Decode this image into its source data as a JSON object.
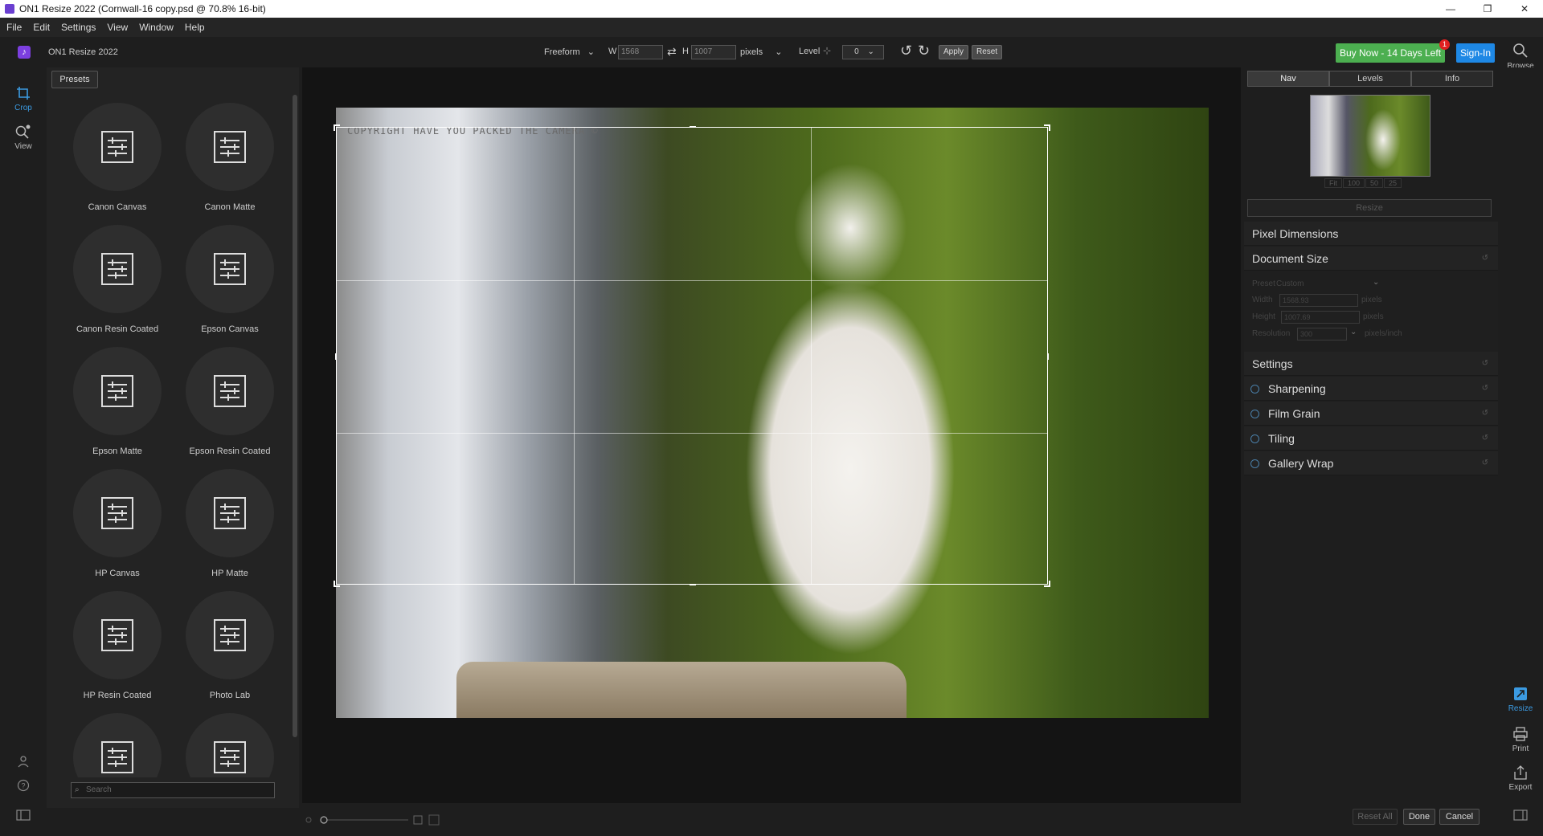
{
  "window": {
    "title": "ON1 Resize 2022 (Cornwall-16 copy.psd @ 70.8% 16-bit)",
    "controls": [
      "—",
      "❐",
      "✕"
    ]
  },
  "menu": [
    "File",
    "Edit",
    "Settings",
    "View",
    "Window",
    "Help"
  ],
  "toolbar": {
    "app_name": "ON1 Resize 2022",
    "ratio": "Freeform",
    "w_label": "W",
    "w_value": "1568",
    "h_label": "H",
    "h_value": "1007",
    "units": "pixels",
    "level_label": "Level",
    "level_value": "0",
    "apply": "Apply",
    "reset": "Reset",
    "buy_now": "Buy Now - 14 Days Left",
    "badge": "1",
    "sign_in": "Sign-In",
    "browse": "Browse"
  },
  "left_rail": {
    "crop": "Crop",
    "view": "View"
  },
  "presets": {
    "tab": "Presets",
    "items": [
      "Canon Canvas",
      "Canon Matte",
      "Canon Resin Coated",
      "Epson Canvas",
      "Epson Matte",
      "Epson Resin Coated",
      "HP Canvas",
      "HP Matte",
      "HP Resin Coated",
      "Photo Lab",
      "",
      ""
    ],
    "search_placeholder": "Search"
  },
  "canvas": {
    "watermark": "COPYRIGHT HAVE YOU PACKED THE CAMERA ©"
  },
  "right_panel": {
    "tabs": [
      "Nav",
      "Levels",
      "Info"
    ],
    "zoom_options": [
      "Fit",
      "100",
      "50",
      "25"
    ],
    "resize_field": "Resize",
    "pixel_dimensions": "Pixel Dimensions",
    "document_size": "Document Size",
    "doc": {
      "preset_label": "Preset",
      "preset_value": "Custom",
      "width_label": "Width",
      "width_value": "1568.93",
      "width_unit": "pixels",
      "height_label": "Height",
      "height_value": "1007.69",
      "height_unit": "pixels",
      "resolution_label": "Resolution",
      "resolution_value": "300",
      "resolution_unit": "pixels/inch"
    },
    "settings": "Settings",
    "sharpening": "Sharpening",
    "film_grain": "Film Grain",
    "tiling": "Tiling",
    "gallery_wrap": "Gallery Wrap"
  },
  "right_rail": {
    "resize": "Resize",
    "print": "Print",
    "export": "Export"
  },
  "footer": {
    "reset_all": "Reset All",
    "done": "Done",
    "cancel": "Cancel"
  },
  "colors": {
    "accent_blue": "#3b9ae1",
    "buy_green": "#4caf50",
    "signin_blue": "#1e88e5"
  }
}
